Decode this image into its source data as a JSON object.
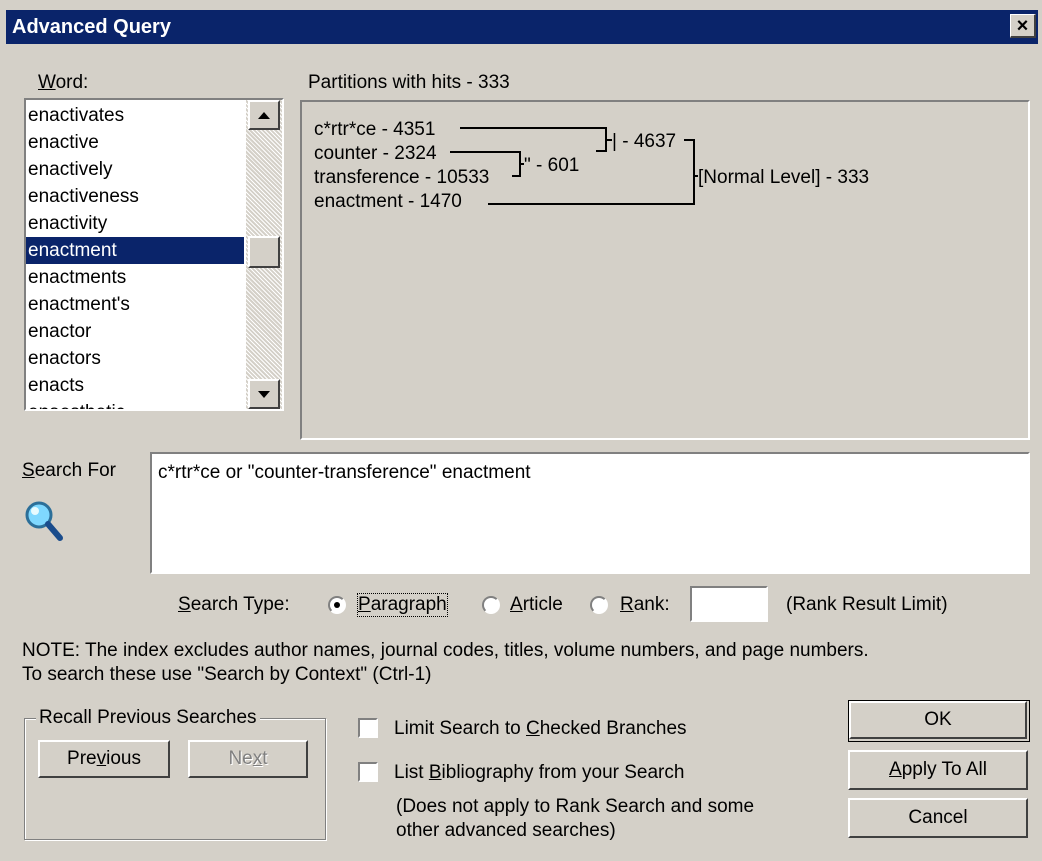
{
  "window": {
    "title": "Advanced Query",
    "close_glyph": "×"
  },
  "word_list": {
    "label": "Word:",
    "items": [
      "enactivates",
      "enactive",
      "enactively",
      "enactiveness",
      "enactivity",
      "enactment",
      "enactments",
      "enactment's",
      "enactor",
      "enactors",
      "enacts",
      "enaesthetic"
    ],
    "selected": "enactment"
  },
  "partitions": {
    "header": "Partitions with hits - 333",
    "terms": [
      "c*rtr*ce - 4351",
      "counter - 2324",
      "transference - 10533",
      "enactment - 1470"
    ],
    "phrase_node": "\" - 601",
    "or_node": "| - 4637",
    "root_node": "[Normal Level] - 333"
  },
  "search": {
    "label": "Search For",
    "query": "c*rtr*ce or \"counter-transference\" enactment",
    "icon": "magnifier-icon"
  },
  "search_type": {
    "label": "Search Type:",
    "options": [
      "Paragraph",
      "Article",
      "Rank:"
    ],
    "selected": "Paragraph",
    "rank_value": "",
    "rank_hint": "(Rank Result Limit)"
  },
  "note": {
    "line1": "NOTE: The index excludes author names, journal codes, titles, volume numbers, and page numbers.",
    "line2": "To search these use \"Search by Context\" (Ctrl-1)"
  },
  "recall": {
    "label": "Recall Previous Searches",
    "previous": "Previous",
    "next": "Next"
  },
  "options": {
    "limit_branches": "Limit Search to Checked Branches",
    "list_bibliography": "List Bibliography from your Search",
    "bib_note_line1": "(Does not apply to Rank Search and some",
    "bib_note_line2": "other advanced searches)",
    "limit_checked": false,
    "bib_checked": false
  },
  "buttons": {
    "ok": "OK",
    "apply_all": "Apply To All",
    "cancel": "Cancel"
  },
  "colors": {
    "titlebar": "#0a246a",
    "face": "#d4d0c8",
    "selection": "#0a246a"
  }
}
